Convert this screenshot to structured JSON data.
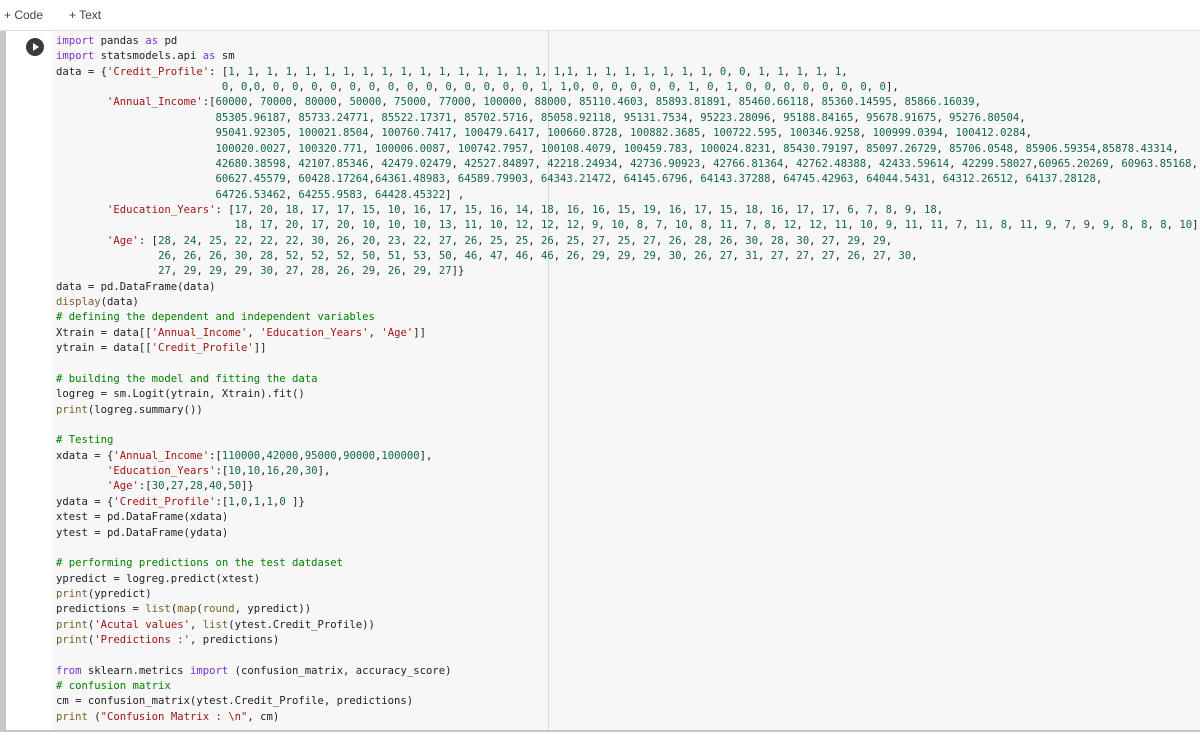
{
  "toolbar": {
    "code_label": "+ Code",
    "text_label": "+ Text"
  },
  "cell": {
    "code_lines": [
      "import pandas as pd",
      "import statsmodels.api as sm",
      "data = {'Credit_Profile': [1, 1, 1, 1, 1, 1, 1, 1, 1, 1, 1, 1, 1, 1, 1, 1, 1, 1,1, 1, 1, 1, 1, 1, 1, 1, 0, 0, 1, 1, 1, 1, 1,",
      "                          0, 0,0, 0, 0, 0, 0, 0, 0, 0, 0, 0, 0, 0, 0, 0, 0, 1, 1,0, 0, 0, 0, 0, 0, 1, 0, 1, 0, 0, 0, 0, 0, 0, 0, 0],",
      "        'Annual_Income':[60000, 70000, 80000, 50000, 75000, 77000, 100000, 88000, 85110.4603, 85893.81891, 85460.66118, 85360.14595, 85866.16039,",
      "                         85305.96187, 85733.24771, 85522.17371, 85702.5716, 85058.92118, 95131.7534, 95223.28096, 95188.84165, 95678.91675, 95276.80504,",
      "                         95041.92305, 100021.8504, 100760.7417, 100479.6417, 100660.8728, 100882.3685, 100722.595, 100346.9258, 100999.0394, 100412.0284,",
      "                         100020.0027, 100320.771, 100006.0087, 100742.7957, 100108.4079, 100459.783, 100024.8231, 85430.79197, 85097.26729, 85706.0548, 85906.59354,85878.43314,",
      "                         42680.38598, 42107.85346, 42479.02479, 42527.84897, 42218.24934, 42736.90923, 42766.81364, 42762.48388, 42433.59614, 42299.58027,60965.20269, 60963.85168,",
      "                         60627.45579, 60428.17264,64361.48983, 64589.79903, 64343.21472, 64145.6796, 64143.37288, 64745.42963, 64044.5431, 64312.26512, 64137.28128,",
      "                         64726.53462, 64255.9583, 64428.45322] ,",
      "        'Education_Years': [17, 20, 18, 17, 17, 15, 10, 16, 17, 15, 16, 14, 18, 16, 16, 15, 19, 16, 17, 15, 18, 16, 17, 17, 6, 7, 8, 9, 18,",
      "                            18, 17, 20, 17, 20, 10, 10, 10, 13, 11, 10, 12, 12, 12, 9, 10, 8, 7, 10, 8, 11, 7, 8, 12, 12, 11, 10, 9, 11, 11, 7, 11, 8, 11, 9, 7, 9, 9, 8, 8, 8, 10],",
      "        'Age': [28, 24, 25, 22, 22, 22, 30, 26, 20, 23, 22, 27, 26, 25, 25, 26, 25, 27, 25, 27, 26, 28, 26, 30, 28, 30, 27, 29, 29,",
      "                26, 26, 26, 30, 28, 52, 52, 52, 50, 51, 53, 50, 46, 47, 46, 46, 26, 29, 29, 29, 30, 26, 27, 31, 27, 27, 27, 26, 27, 30,",
      "                27, 29, 29, 29, 30, 27, 28, 26, 29, 26, 29, 27]}",
      "data = pd.DataFrame(data)",
      "display(data)",
      "# defining the dependent and independent variables",
      "Xtrain = data[['Annual_Income', 'Education_Years', 'Age']]",
      "ytrain = data[['Credit_Profile']]",
      "",
      "# building the model and fitting the data",
      "logreg = sm.Logit(ytrain, Xtrain).fit()",
      "print(logreg.summary())",
      "",
      "# Testing",
      "xdata = {'Annual_Income':[110000,42000,95000,90000,100000],",
      "        'Education_Years':[10,10,16,20,30],",
      "        'Age':[30,27,28,40,50]}",
      "ydata = {'Credit_Profile':[1,0,1,1,0 ]}",
      "xtest = pd.DataFrame(xdata)",
      "ytest = pd.DataFrame(ydata)",
      "",
      "# performing predictions on the test datdaset",
      "ypredict = logreg.predict(xtest)",
      "print(ypredict)",
      "predictions = list(map(round, ypredict))",
      "print('Acutal values', list(ytest.Credit_Profile))",
      "print('Predictions :', predictions)",
      "",
      "from sklearn.metrics import (confusion_matrix, accuracy_score)",
      "# confusion matrix",
      "cm = confusion_matrix(ytest.Credit_Profile, predictions)",
      "print (\"Confusion Matrix : \\n\", cm)"
    ]
  },
  "colors": {
    "keyword": "#7b30d0",
    "string": "#a31515",
    "number": "#116644",
    "comment": "#008000",
    "builtin": "#795e26",
    "editor_bg": "#f7f7f7"
  },
  "icons": {
    "run": "play-icon"
  }
}
